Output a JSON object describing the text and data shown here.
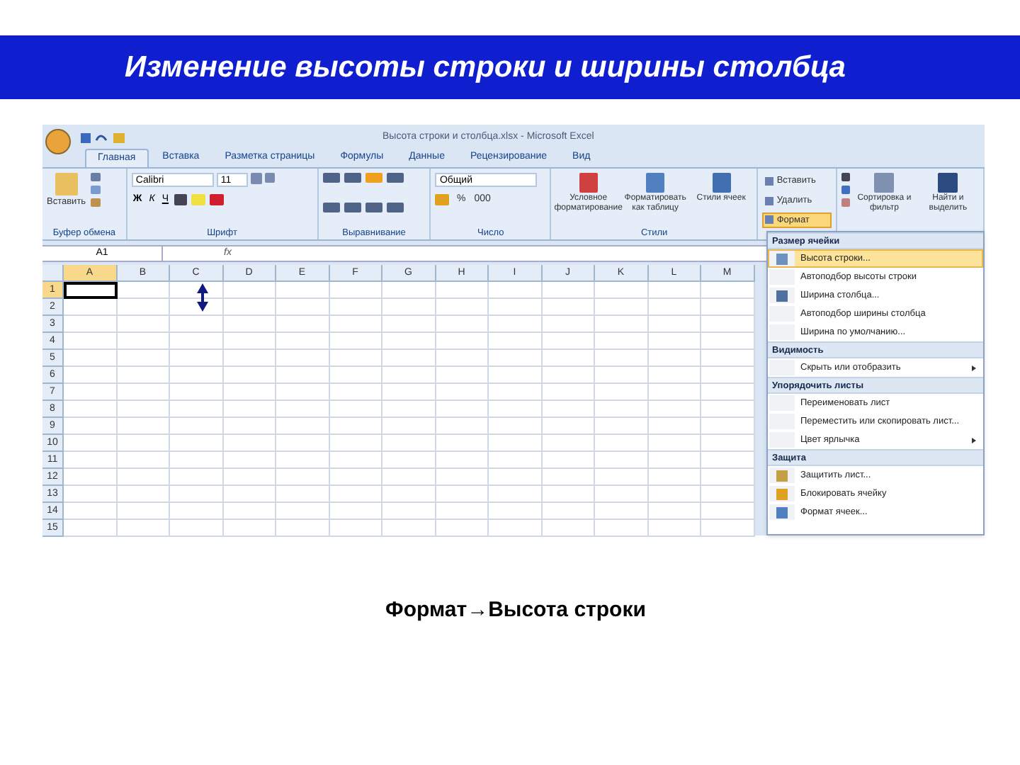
{
  "slide_title": "Изменение высоты строки и ширины столбца",
  "excel": {
    "window_title": "Высота строки и столбца.xlsx - Microsoft Excel",
    "tabs": [
      {
        "label": "Главная",
        "selected": true
      },
      {
        "label": "Вставка",
        "selected": false
      },
      {
        "label": "Разметка страницы",
        "selected": false
      },
      {
        "label": "Формулы",
        "selected": false
      },
      {
        "label": "Данные",
        "selected": false
      },
      {
        "label": "Рецензирование",
        "selected": false
      },
      {
        "label": "Вид",
        "selected": false
      }
    ],
    "ribbon": {
      "clipboard": {
        "paste": "Вставить",
        "label": "Буфер обмена"
      },
      "font": {
        "name": "Calibri",
        "size": "11",
        "bold": "Ж",
        "italic": "К",
        "underline": "Ч",
        "label": "Шрифт"
      },
      "alignment": {
        "label": "Выравнивание"
      },
      "number": {
        "format": "Общий",
        "percent": "%",
        "thousands": "000",
        "label": "Число"
      },
      "styles": {
        "buttons": [
          "Условное форматирование",
          "Форматировать как таблицу",
          "Стили ячеек"
        ],
        "label": "Стили"
      },
      "cells": [
        {
          "label": "Вставить",
          "selected": false
        },
        {
          "label": "Удалить",
          "selected": false
        },
        {
          "label": "Формат",
          "selected": true
        }
      ],
      "editing": {
        "sort": "Сортировка и фильтр",
        "find": "Найти и выделить"
      }
    },
    "name_box": "A1",
    "fx": "fx",
    "columns": [
      {
        "label": "A",
        "selected": true
      },
      {
        "label": "B",
        "selected": false
      },
      {
        "label": "C",
        "selected": false
      },
      {
        "label": "D",
        "selected": false
      },
      {
        "label": "E",
        "selected": false
      },
      {
        "label": "F",
        "selected": false
      },
      {
        "label": "G",
        "selected": false
      },
      {
        "label": "H",
        "selected": false
      },
      {
        "label": "I",
        "selected": false
      },
      {
        "label": "J",
        "selected": false
      },
      {
        "label": "K",
        "selected": false
      },
      {
        "label": "L",
        "selected": false
      },
      {
        "label": "M",
        "selected": false
      }
    ],
    "rows": [
      {
        "label": "1",
        "selected": true
      },
      {
        "label": "2",
        "selected": false
      },
      {
        "label": "3",
        "selected": false
      },
      {
        "label": "4",
        "selected": false
      },
      {
        "label": "5",
        "selected": false
      },
      {
        "label": "6",
        "selected": false
      },
      {
        "label": "7",
        "selected": false
      },
      {
        "label": "8",
        "selected": false
      },
      {
        "label": "9",
        "selected": false
      },
      {
        "label": "10",
        "selected": false
      },
      {
        "label": "11",
        "selected": false
      },
      {
        "label": "12",
        "selected": false
      },
      {
        "label": "13",
        "selected": false
      },
      {
        "label": "14",
        "selected": false
      },
      {
        "label": "15",
        "selected": false
      }
    ],
    "format_menu": [
      {
        "kind": "header",
        "label": "Размер ячейки"
      },
      {
        "kind": "icon_item",
        "label": "Высота строки...",
        "selected": true
      },
      {
        "kind": "item",
        "label": "Автоподбор высоты строки",
        "selected": false
      },
      {
        "kind": "icon_item",
        "label": "Ширина столбца...",
        "selected": false
      },
      {
        "kind": "item",
        "label": "Автоподбор ширины столбца",
        "selected": false
      },
      {
        "kind": "item",
        "label": "Ширина по умолчанию...",
        "selected": false
      },
      {
        "kind": "header",
        "label": "Видимость"
      },
      {
        "kind": "item",
        "label": "Скрыть или отобразить",
        "submenu": true,
        "selected": false
      },
      {
        "kind": "header",
        "label": "Упорядочить листы"
      },
      {
        "kind": "item",
        "label": "Переименовать лист",
        "selected": false
      },
      {
        "kind": "item",
        "label": "Переместить или скопировать лист...",
        "selected": false
      },
      {
        "kind": "item",
        "label": "Цвет ярлычка",
        "submenu": true,
        "selected": false
      },
      {
        "kind": "header",
        "label": "Защита"
      },
      {
        "kind": "icon_item",
        "label": "Защитить лист...",
        "selected": false
      },
      {
        "kind": "icon_item",
        "label": "Блокировать ячейку",
        "selected": false
      },
      {
        "kind": "icon_item",
        "label": "Формат ячеек...",
        "selected": false
      }
    ]
  },
  "caption": "Формат→Высота строки"
}
